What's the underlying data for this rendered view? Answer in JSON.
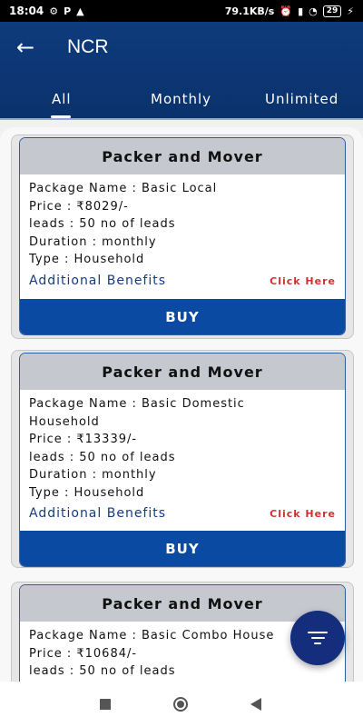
{
  "status": {
    "time": "18:04",
    "left_icons": [
      "settings-icon",
      "p-icon",
      "warning-icon"
    ],
    "network_speed": "79.1KB/s",
    "battery": "29"
  },
  "header": {
    "title": "NCR",
    "tabs": [
      "All",
      "Monthly",
      "Unlimited"
    ],
    "active_tab": "All"
  },
  "cards": [
    {
      "title": "Packer and Mover",
      "lines": [
        "Package Name : Basic Local",
        "Price : ₹8029/-",
        "leads : 50 no of leads",
        "Duration : monthly",
        "Type : Household"
      ],
      "benefits_label": "Additional Benefits",
      "click_here_label": "Click Here",
      "buy_label": "BUY"
    },
    {
      "title": "Packer and Mover",
      "lines": [
        "Package Name : Basic Domestic",
        "Household",
        "Price : ₹13339/-",
        "leads : 50 no of leads",
        "Duration : monthly",
        "Type : Household"
      ],
      "benefits_label": "Additional Benefits",
      "click_here_label": "Click Here",
      "buy_label": "BUY"
    },
    {
      "title": "Packer and Mover",
      "lines": [
        "Package Name : Basic Combo House",
        "Price : ₹10684/-",
        "leads : 50 no of leads"
      ],
      "benefits_label": "",
      "click_here_label": "",
      "buy_label": ""
    }
  ],
  "colors": {
    "header_bg": "#0e3b7d",
    "card_head_bg": "#c6c8cf",
    "buy_bg": "#0a4aa3",
    "benefits_text": "#163a84",
    "click_here_text": "#d32f2f",
    "fab_bg": "#142d7c"
  },
  "icons": {
    "back": "back-arrow-icon",
    "filter": "filter-icon"
  }
}
